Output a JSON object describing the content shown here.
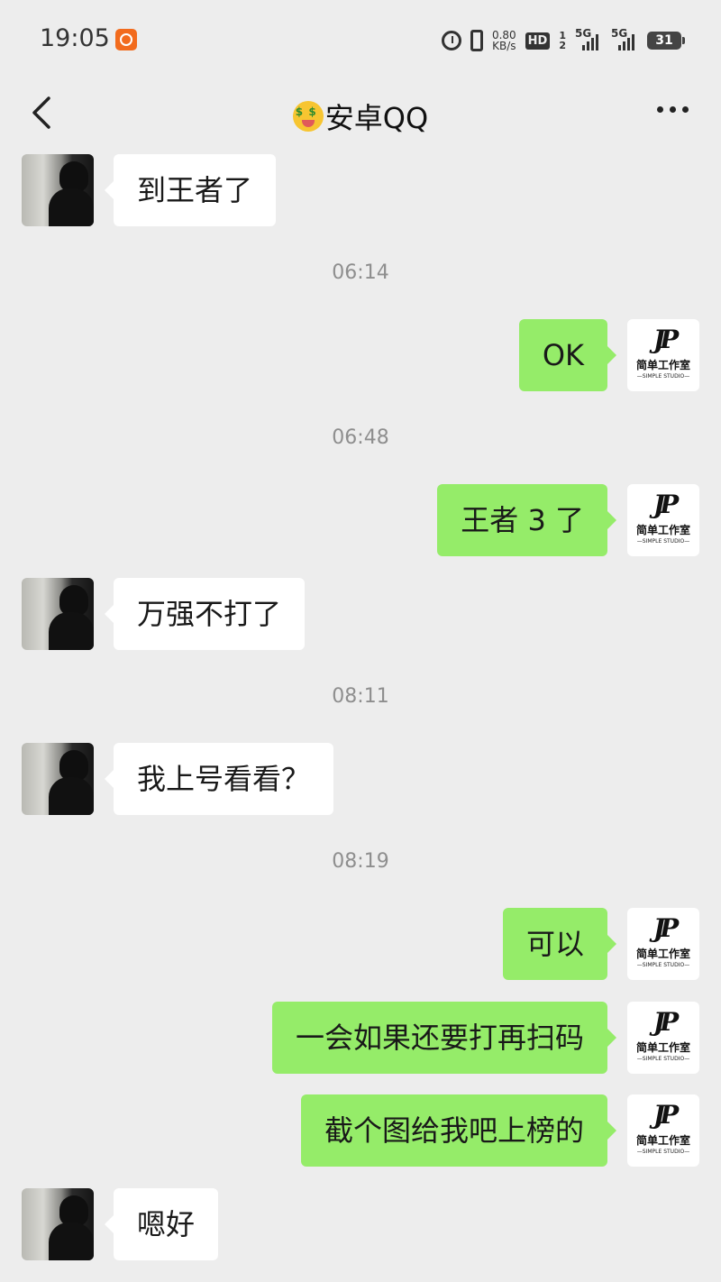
{
  "status_bar": {
    "time": "19:05",
    "net_speed_value": "0.80",
    "net_speed_unit": "KB/s",
    "hd_label": "HD",
    "sim_index_top": "1",
    "sim_index_bottom": "2",
    "sim1_label": "5G",
    "sim2_label": "5G",
    "battery": "31"
  },
  "header": {
    "title": "安卓QQ"
  },
  "avatar_self": {
    "logo_mark": "JP",
    "logo_cn": "简单工作室",
    "logo_en": "—SIMPLE STUDIO—"
  },
  "messages": [
    {
      "sender": "peer",
      "text": "到王者了"
    },
    {
      "time": "06:14"
    },
    {
      "sender": "self",
      "text": "OK"
    },
    {
      "time": "06:48"
    },
    {
      "sender": "self",
      "text": "王者 3 了"
    },
    {
      "sender": "peer",
      "text": "万强不打了"
    },
    {
      "time": "08:11"
    },
    {
      "sender": "peer",
      "text": "我上号看看？"
    },
    {
      "time": "08:19"
    },
    {
      "sender": "self",
      "text": "可以"
    },
    {
      "sender": "self",
      "text": "一会如果还要打再扫码"
    },
    {
      "sender": "self",
      "text": "截个图给我吧上榜的"
    },
    {
      "sender": "peer",
      "text": "嗯好"
    }
  ]
}
